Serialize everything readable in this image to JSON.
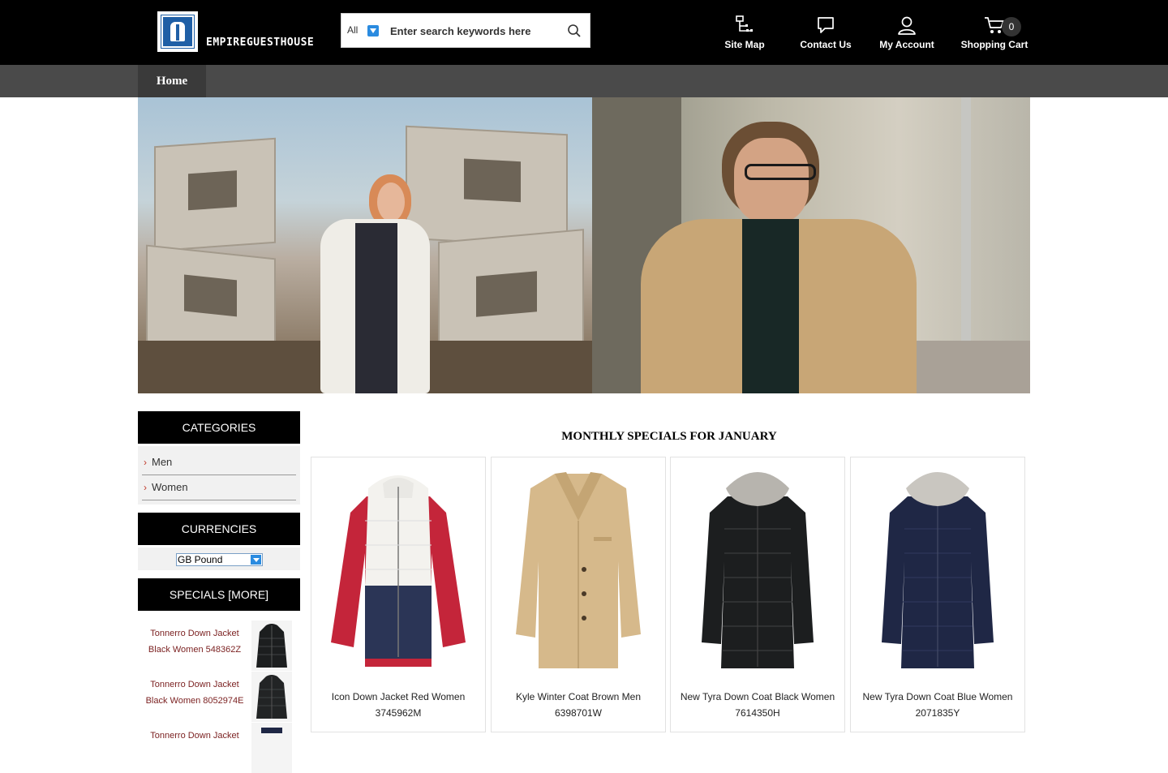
{
  "header": {
    "logo_text": "EMPIREGUESTHOUSE",
    "search": {
      "category": "All",
      "placeholder": "Enter search keywords here"
    },
    "nav": [
      {
        "label": "Site Map",
        "icon": "sitemap-icon"
      },
      {
        "label": "Contact Us",
        "icon": "chat-bubble-icon"
      },
      {
        "label": "My Account",
        "icon": "user-icon"
      },
      {
        "label": "Shopping Cart",
        "icon": "cart-icon"
      }
    ],
    "cart_count": "0"
  },
  "menu": {
    "home": "Home"
  },
  "sidebar": {
    "categories_title": "CATEGORIES",
    "categories": [
      {
        "label": "Men"
      },
      {
        "label": "Women"
      }
    ],
    "currencies_title": "CURRENCIES",
    "currency_selected": "GB Pound",
    "specials_title": "SPECIALS  [MORE]",
    "specials": [
      {
        "line1": "Tonnerro Down Jacket",
        "line2": "Black Women 548362Z"
      },
      {
        "line1": "Tonnerro Down Jacket",
        "line2": "Black Women 8052974E"
      },
      {
        "line1": "Tonnerro Down Jacket",
        "line2": ""
      }
    ]
  },
  "main": {
    "title": "MONTHLY SPECIALS FOR JANUARY",
    "products": [
      {
        "line1": "Icon Down Jacket Red Women",
        "line2": "3745962M",
        "color": "#c4253a"
      },
      {
        "line1": "Kyle Winter Coat Brown Men",
        "line2": "6398701W",
        "color": "#d6b98b"
      },
      {
        "line1": "New Tyra Down Coat Black Women",
        "line2": "7614350H",
        "color": "#1c1e1f"
      },
      {
        "line1": "New Tyra Down Coat Blue Women",
        "line2": "2071835Y",
        "color": "#1f2745"
      }
    ]
  }
}
